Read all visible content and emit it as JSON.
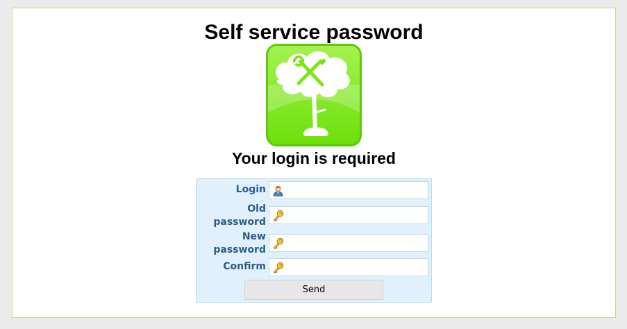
{
  "page": {
    "title": "Self service password",
    "subtitle": "Your login is required"
  },
  "logo": {
    "icon": "ltb-tree-logo",
    "colors": {
      "green": "#7ee51a",
      "dark_green": "#5fc80f",
      "white": "#ffffff"
    }
  },
  "form": {
    "fields": [
      {
        "name": "login",
        "label": "Login",
        "icon": "user-icon",
        "value": ""
      },
      {
        "name": "oldpassword",
        "label_line1": "Old",
        "label_line2": "password",
        "icon": "key-icon",
        "value": ""
      },
      {
        "name": "newpassword",
        "label_line1": "New",
        "label_line2": "password",
        "icon": "key-icon",
        "value": ""
      },
      {
        "name": "confirmpassword",
        "label": "Confirm",
        "icon": "key-icon",
        "value": ""
      }
    ],
    "submit_label": "Send"
  },
  "colors": {
    "page_background": "#ebebeb",
    "frame_border": "#c5d88a",
    "form_background": "#e0f1fd",
    "label_text": "#2d5d84"
  }
}
